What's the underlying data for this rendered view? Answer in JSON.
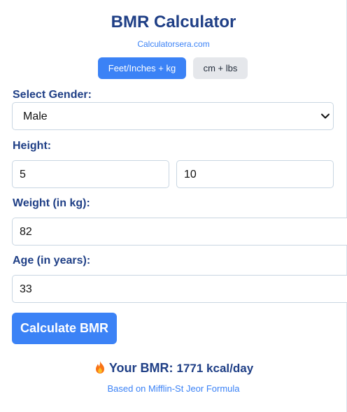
{
  "header": {
    "title": "BMR Calculator",
    "site": "Calculatorsera.com"
  },
  "units": {
    "imperial_label": "Feet/Inches + kg",
    "metric_label": "cm + lbs",
    "selected": "imperial"
  },
  "form": {
    "gender_label": "Select Gender:",
    "gender_value": "Male",
    "height_label": "Height:",
    "height_feet": "5",
    "height_inches": "10",
    "weight_label": "Weight (in kg):",
    "weight_value": "82",
    "age_label": "Age (in years):",
    "age_value": "33",
    "submit_label": "Calculate BMR"
  },
  "result": {
    "icon": "flame-icon",
    "label": "Your BMR:",
    "value": "1771 kcal/day",
    "note": "Based on Mifflin-St Jeor Formula"
  },
  "colors": {
    "accent": "#3b82f6",
    "heading": "#1f3f86",
    "inactive_button": "#e5e7eb"
  }
}
